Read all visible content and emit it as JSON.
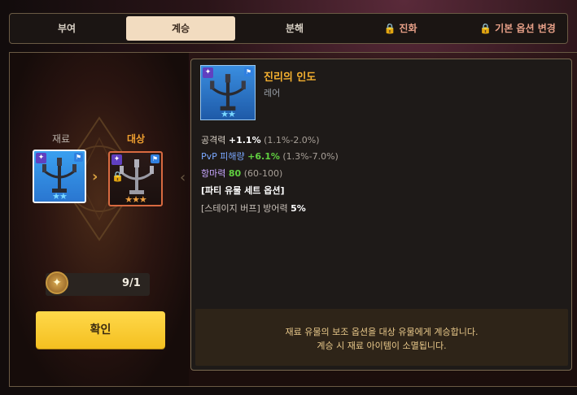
{
  "tabs": [
    {
      "label": "부여",
      "active": false,
      "locked": false
    },
    {
      "label": "계승",
      "active": true,
      "locked": false
    },
    {
      "label": "분해",
      "active": false,
      "locked": false
    },
    {
      "label": "진화",
      "active": false,
      "locked": true
    },
    {
      "label": "기본 옵션 변경",
      "active": false,
      "locked": true
    }
  ],
  "slots": {
    "material_label": "재료",
    "target_label": "대상",
    "material_stars": "★★",
    "target_stars": "★★★"
  },
  "counter": {
    "value": "9/1"
  },
  "confirm_label": "확인",
  "item": {
    "name": "진리의 인도",
    "rarity": "레어",
    "stars": "★★"
  },
  "stats": {
    "attack": {
      "label": "공격력",
      "value": "+1.1%",
      "range": "(1.1%-2.0%)"
    },
    "pvp": {
      "label": "PvP 피해량",
      "value": "+6.1%",
      "range": "(1.3%-7.0%)"
    },
    "magic": {
      "label": "항마력",
      "value": "80",
      "range": "(60-100)"
    },
    "set_option": "[파티 유물 세트 옵션]",
    "buff": {
      "label": "[스테이지 버프] 방어력",
      "value": "5%"
    }
  },
  "notice": {
    "line1": "재료 유물의 보조 옵션을 대상 유물에게 계승합니다.",
    "line2": "계승 시 재료 아이템이 소멸됩니다."
  },
  "colors": {
    "accent_yellow": "#f4c020",
    "item_name": "#f4b030",
    "lock_red": "#e0523a",
    "stat_green": "#60d040"
  }
}
